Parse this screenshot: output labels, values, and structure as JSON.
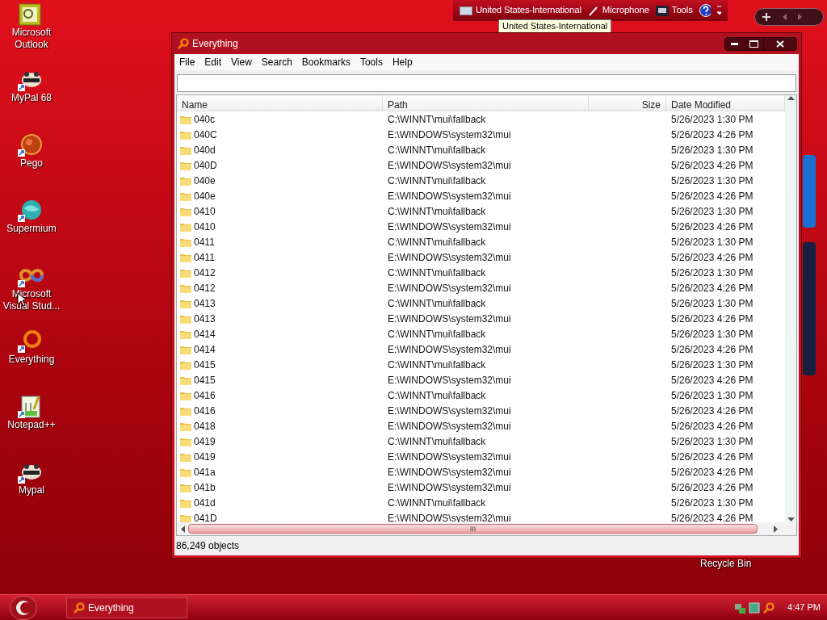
{
  "desktop_icons": [
    {
      "label": "Microsoft Outlook"
    },
    {
      "label": "MyPal 68"
    },
    {
      "label": "Pego"
    },
    {
      "label": "Supermium"
    },
    {
      "label": "Microsoft Visual Stud..."
    },
    {
      "label": "Everything"
    },
    {
      "label": "Notepad++"
    },
    {
      "label": "Mypal"
    }
  ],
  "language_bar": {
    "items": [
      "United States-International",
      "Microphone",
      "Tools"
    ],
    "tooltip": "United States-International"
  },
  "recycle_bin": {
    "label": "Recycle Bin"
  },
  "window": {
    "title": "Everything",
    "menu": [
      "File",
      "Edit",
      "View",
      "Search",
      "Bookmarks",
      "Tools",
      "Help"
    ],
    "table": {
      "columns": [
        "Name",
        "Path",
        "Size",
        "Date Modified"
      ],
      "rows": [
        {
          "name": "040c",
          "path": "C:\\WINNT\\mui\\fallback",
          "date": "5/26/2023 1:30 PM"
        },
        {
          "name": "040C",
          "path": "E:\\WINDOWS\\system32\\mui",
          "date": "5/26/2023 4:26 PM"
        },
        {
          "name": "040d",
          "path": "C:\\WINNT\\mui\\fallback",
          "date": "5/26/2023 1:30 PM"
        },
        {
          "name": "040D",
          "path": "E:\\WINDOWS\\system32\\mui",
          "date": "5/26/2023 4:26 PM"
        },
        {
          "name": "040e",
          "path": "C:\\WINNT\\mui\\fallback",
          "date": "5/26/2023 1:30 PM"
        },
        {
          "name": "040e",
          "path": "E:\\WINDOWS\\system32\\mui",
          "date": "5/26/2023 4:26 PM"
        },
        {
          "name": "0410",
          "path": "C:\\WINNT\\mui\\fallback",
          "date": "5/26/2023 1:30 PM"
        },
        {
          "name": "0410",
          "path": "E:\\WINDOWS\\system32\\mui",
          "date": "5/26/2023 4:26 PM"
        },
        {
          "name": "0411",
          "path": "C:\\WINNT\\mui\\fallback",
          "date": "5/26/2023 1:30 PM"
        },
        {
          "name": "0411",
          "path": "E:\\WINDOWS\\system32\\mui",
          "date": "5/26/2023 4:26 PM"
        },
        {
          "name": "0412",
          "path": "C:\\WINNT\\mui\\fallback",
          "date": "5/26/2023 1:30 PM"
        },
        {
          "name": "0412",
          "path": "E:\\WINDOWS\\system32\\mui",
          "date": "5/26/2023 4:26 PM"
        },
        {
          "name": "0413",
          "path": "C:\\WINNT\\mui\\fallback",
          "date": "5/26/2023 1:30 PM"
        },
        {
          "name": "0413",
          "path": "E:\\WINDOWS\\system32\\mui",
          "date": "5/26/2023 4:26 PM"
        },
        {
          "name": "0414",
          "path": "C:\\WINNT\\mui\\fallback",
          "date": "5/26/2023 1:30 PM"
        },
        {
          "name": "0414",
          "path": "E:\\WINDOWS\\system32\\mui",
          "date": "5/26/2023 4:26 PM"
        },
        {
          "name": "0415",
          "path": "C:\\WINNT\\mui\\fallback",
          "date": "5/26/2023 1:30 PM"
        },
        {
          "name": "0415",
          "path": "E:\\WINDOWS\\system32\\mui",
          "date": "5/26/2023 4:26 PM"
        },
        {
          "name": "0416",
          "path": "C:\\WINNT\\mui\\fallback",
          "date": "5/26/2023 1:30 PM"
        },
        {
          "name": "0416",
          "path": "E:\\WINDOWS\\system32\\mui",
          "date": "5/26/2023 4:26 PM"
        },
        {
          "name": "0418",
          "path": "E:\\WINDOWS\\system32\\mui",
          "date": "5/26/2023 4:26 PM"
        },
        {
          "name": "0419",
          "path": "C:\\WINNT\\mui\\fallback",
          "date": "5/26/2023 1:30 PM"
        },
        {
          "name": "0419",
          "path": "E:\\WINDOWS\\system32\\mui",
          "date": "5/26/2023 4:26 PM"
        },
        {
          "name": "041a",
          "path": "E:\\WINDOWS\\system32\\mui",
          "date": "5/26/2023 4:26 PM"
        },
        {
          "name": "041b",
          "path": "E:\\WINDOWS\\system32\\mui",
          "date": "5/26/2023 4:26 PM"
        },
        {
          "name": "041d",
          "path": "C:\\WINNT\\mui\\fallback",
          "date": "5/26/2023 1:30 PM"
        },
        {
          "name": "041D",
          "path": "E:\\WINDOWS\\system32\\mui",
          "date": "5/26/2023 4:26 PM"
        }
      ]
    },
    "status_bar": "86,249 objects"
  },
  "taskbar": {
    "tasks": [
      {
        "label": "Everything",
        "selected": true
      }
    ],
    "clock": "4:47 PM"
  }
}
